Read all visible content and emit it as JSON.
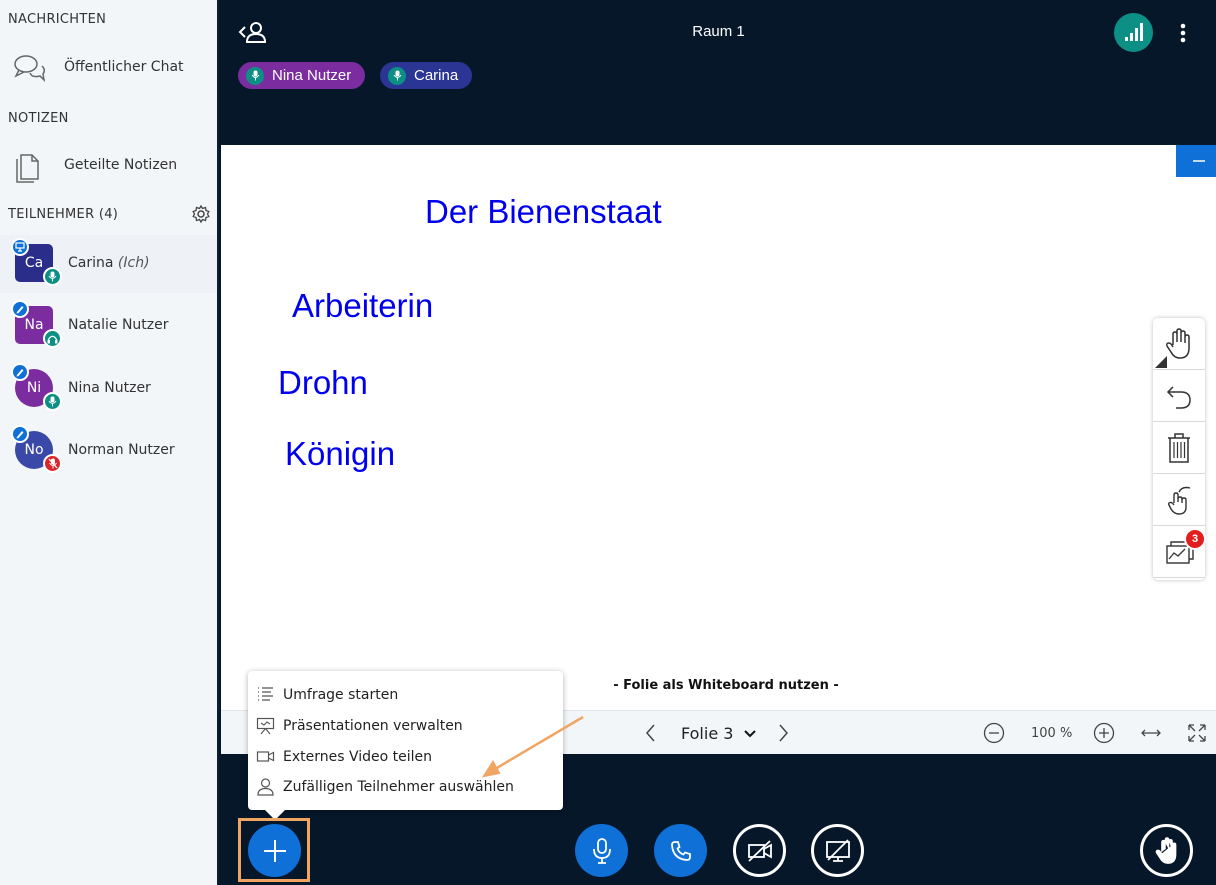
{
  "sidebar": {
    "messages_title": "NACHRICHTEN",
    "public_chat": "Öffentlicher Chat",
    "notes_title": "NOTIZEN",
    "shared_notes": "Geteilte Notizen",
    "participants_title": "TEILNEHMER (4)",
    "users": [
      {
        "initials": "Ca",
        "name": "Carina",
        "suffix": "(Ich)",
        "color": "#2a2d8a"
      },
      {
        "initials": "Na",
        "name": "Natalie Nutzer",
        "suffix": "",
        "color": "#7b2da0"
      },
      {
        "initials": "Ni",
        "name": "Nina Nutzer",
        "suffix": "",
        "color": "#7b2da0"
      },
      {
        "initials": "No",
        "name": "Norman Nutzer",
        "suffix": "",
        "color": "#3a48a8"
      }
    ]
  },
  "header": {
    "room_title": "Raum 1",
    "talkers": [
      {
        "name": "Nina Nutzer",
        "color": "#7b2da0"
      },
      {
        "name": "Carina",
        "color": "#2a3594"
      }
    ]
  },
  "whiteboard": {
    "words": [
      "Der Bienenstaat",
      "Arbeiterin",
      "Drohn",
      "Königin"
    ],
    "caption": "- Folie als Whiteboard nutzen -",
    "tool_badge": "3"
  },
  "slide_nav": {
    "slide_label": "Folie 3",
    "zoom": "100 %"
  },
  "actions_menu": {
    "items": [
      {
        "label": "Umfrage starten",
        "icon": "list-icon"
      },
      {
        "label": "Präsentationen verwalten",
        "icon": "presentation-icon"
      },
      {
        "label": "Externes Video teilen",
        "icon": "video-icon"
      },
      {
        "label": "Zufälligen Teilnehmer auswählen",
        "icon": "user-icon"
      }
    ]
  },
  "colors": {
    "accent": "#0f70d7",
    "dark_bg": "#06172a",
    "highlight": "#f0a563",
    "board_text": "#0000ee"
  }
}
